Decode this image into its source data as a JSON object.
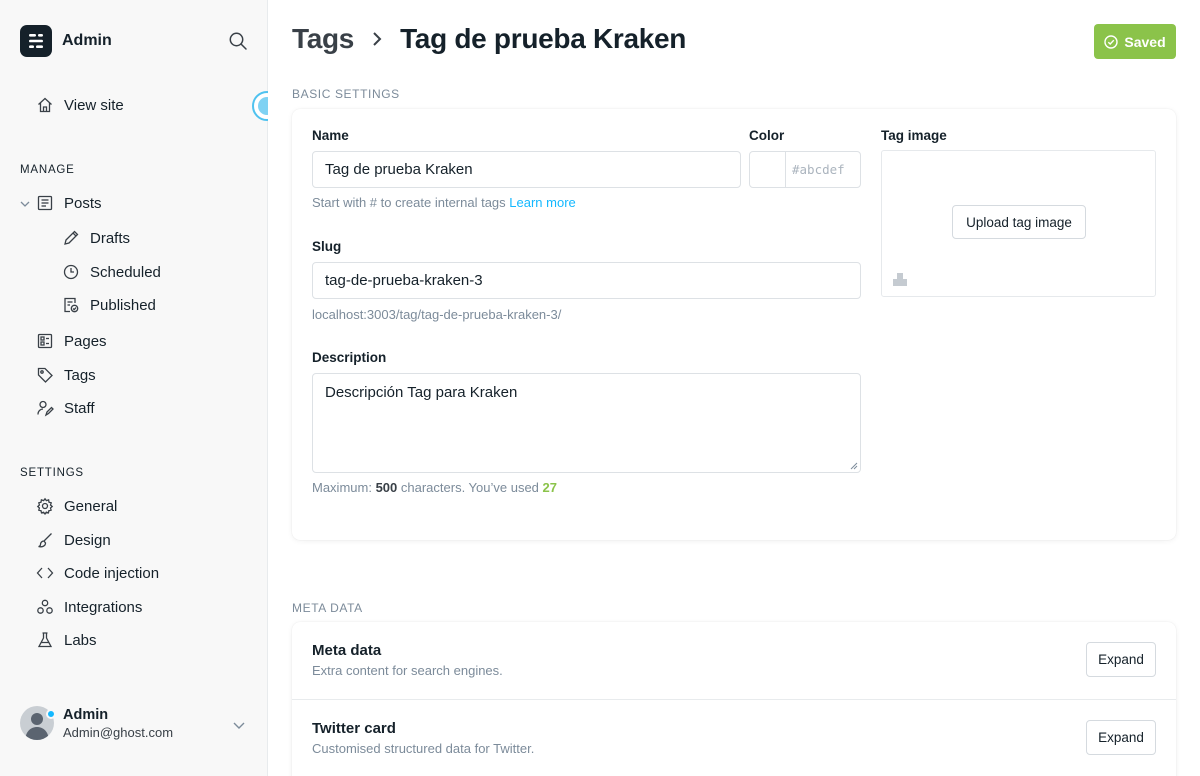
{
  "sidebar": {
    "brand": "Admin",
    "view_site": "View site",
    "manage_title": "MANAGE",
    "posts": "Posts",
    "drafts": "Drafts",
    "scheduled": "Scheduled",
    "published": "Published",
    "pages": "Pages",
    "tags": "Tags",
    "staff": "Staff",
    "settings_title": "SETTINGS",
    "general": "General",
    "design": "Design",
    "code_injection": "Code injection",
    "integrations": "Integrations",
    "labs": "Labs",
    "user": {
      "name": "Admin",
      "email": "Admin@ghost.com"
    }
  },
  "header": {
    "breadcrumb_parent": "Tags",
    "breadcrumb_current": "Tag de prueba Kraken",
    "saved_label": "Saved"
  },
  "basic": {
    "section_title": "BASIC SETTINGS",
    "name_label": "Name",
    "name_value": "Tag de prueba Kraken",
    "name_hint": "Start with # to create internal tags",
    "learn_more": "Learn more",
    "color_label": "Color",
    "color_hash": "#",
    "color_placeholder": "abcdef",
    "slug_label": "Slug",
    "slug_value": "tag-de-prueba-kraken-3",
    "slug_url": "localhost:3003/tag/tag-de-prueba-kraken-3/",
    "description_label": "Description",
    "description_value": "Descripción Tag para Kraken",
    "max_prefix": "Maximum: ",
    "max_count": "500",
    "max_mid": " characters. You’ve used ",
    "used_count": "27",
    "tag_image_label": "Tag image",
    "upload_label": "Upload tag image"
  },
  "meta": {
    "section_title": "META DATA",
    "rows": [
      {
        "title": "Meta data",
        "desc": "Extra content for search engines.",
        "button": "Expand"
      },
      {
        "title": "Twitter card",
        "desc": "Customised structured data for Twitter.",
        "button": "Expand"
      }
    ]
  },
  "colors": {
    "accent": "#14b8ff",
    "saved_green": "#8bc34a",
    "used_green": "#8bc34a"
  }
}
